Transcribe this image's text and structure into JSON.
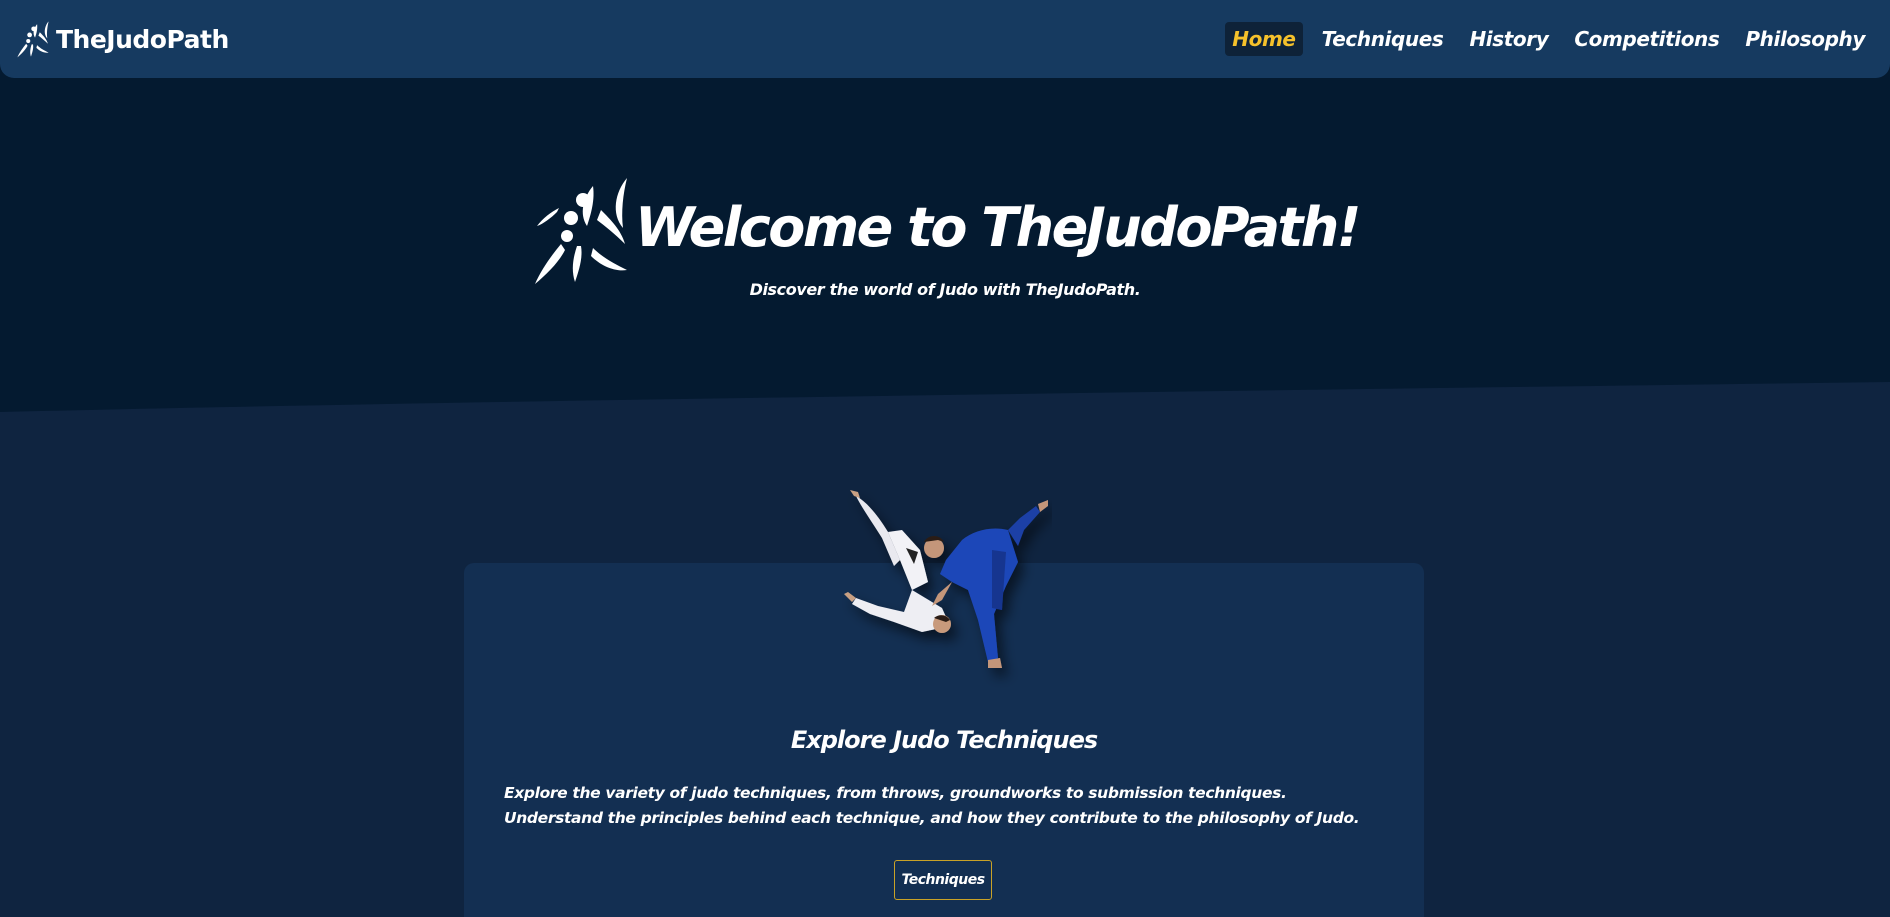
{
  "colors": {
    "navbar_bg": "#163a60",
    "hero_bg": "#041a30",
    "page_bg": "#0f2440",
    "card_bg": "#132f52",
    "accent": "#f5c12b",
    "button_border": "#c9a227"
  },
  "navbar": {
    "brand_name": "TheJudoPath",
    "brand_icon": "judo-throw-icon",
    "links": [
      {
        "label": "Home",
        "active": true
      },
      {
        "label": "Techniques",
        "active": false
      },
      {
        "label": "History",
        "active": false
      },
      {
        "label": "Competitions",
        "active": false
      },
      {
        "label": "Philosophy",
        "active": false
      }
    ]
  },
  "hero": {
    "icon": "judo-throw-icon",
    "title": "Welcome to TheJudoPath!",
    "subtitle": "Discover the world of Judo with TheJudoPath."
  },
  "card": {
    "image": "judo-throw-photo",
    "title": "Explore Judo Techniques",
    "text": "Explore the variety of judo techniques, from throws, groundworks to submission techniques. Understand the principles behind each technique, and how they contribute to the philosophy of Judo.",
    "button_label": "Techniques"
  }
}
